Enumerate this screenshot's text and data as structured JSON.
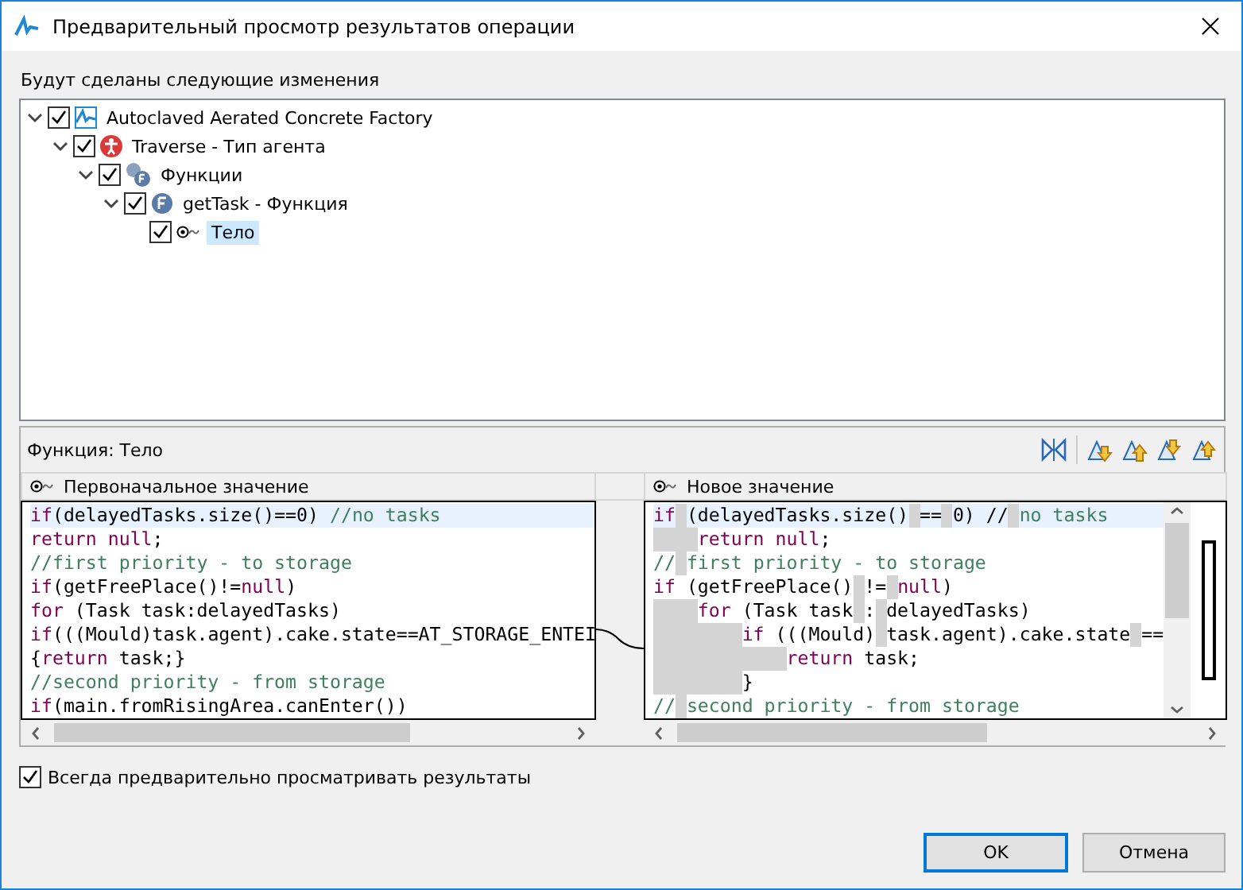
{
  "window": {
    "title": "Предварительный просмотр результатов операции"
  },
  "changes_label": "Будут сделаны следующие изменения",
  "tree": [
    {
      "label": "Autoclaved Aerated Concrete Factory",
      "kind": "model",
      "checked": true,
      "expanded": true,
      "selected": false,
      "children": [
        {
          "label": "Traverse - Тип агента",
          "kind": "agent",
          "checked": true,
          "expanded": true,
          "selected": false,
          "children": [
            {
              "label": "Функции",
              "kind": "functions",
              "checked": true,
              "expanded": true,
              "selected": false,
              "children": [
                {
                  "label": "getTask - Функция",
                  "kind": "function",
                  "checked": true,
                  "expanded": true,
                  "selected": false,
                  "children": [
                    {
                      "label": "Тело",
                      "kind": "body",
                      "checked": true,
                      "selected": true
                    }
                  ]
                }
              ]
            }
          ]
        }
      ]
    }
  ],
  "compare": {
    "title": "Функция: Тело",
    "left": {
      "header": "Первоначальное значение",
      "lines": [
        [
          {
            "kind": "kw",
            "text": "if"
          },
          {
            "kind": "tx",
            "text": "(delayedTasks.size()==0) "
          },
          {
            "kind": "cm",
            "text": "//no tasks"
          }
        ],
        [
          {
            "kind": "kw",
            "text": "return null"
          },
          {
            "kind": "tx",
            "text": ";"
          }
        ],
        [
          {
            "kind": "cm",
            "text": "//first priority - to storage"
          }
        ],
        [
          {
            "kind": "kw",
            "text": "if"
          },
          {
            "kind": "tx",
            "text": "(getFreePlace()!="
          },
          {
            "kind": "kw",
            "text": "null"
          },
          {
            "kind": "tx",
            "text": ")"
          }
        ],
        [
          {
            "kind": "kw",
            "text": "for"
          },
          {
            "kind": "tx",
            "text": " (Task task:delayedTasks)"
          }
        ],
        [
          {
            "kind": "kw",
            "text": "if"
          },
          {
            "kind": "tx",
            "text": "(((Mould)task.agent).cake.state==AT_STORAGE_ENTEI"
          }
        ],
        [
          {
            "kind": "tx",
            "text": "{"
          },
          {
            "kind": "kw",
            "text": "return"
          },
          {
            "kind": "tx",
            "text": " task;}"
          }
        ],
        [
          {
            "kind": "cm",
            "text": "//second priority - from storage"
          }
        ],
        [
          {
            "kind": "kw",
            "text": "if"
          },
          {
            "kind": "tx",
            "text": "(main.fromRisingArea.canEnter())"
          }
        ]
      ]
    },
    "right": {
      "header": "Новое значение",
      "lines": [
        [
          {
            "kind": "kw",
            "text": "if"
          },
          {
            "kind": "gap"
          },
          {
            "kind": "tx",
            "text": "(delayedTasks.size()"
          },
          {
            "kind": "gap"
          },
          {
            "kind": "tx",
            "text": "=="
          },
          {
            "kind": "gap"
          },
          {
            "kind": "tx",
            "text": "0) //"
          },
          {
            "kind": "gap"
          },
          {
            "kind": "cm",
            "text": "no tasks"
          }
        ],
        [
          {
            "kind": "tab"
          },
          {
            "kind": "kw",
            "text": "return null"
          },
          {
            "kind": "tx",
            "text": ";"
          }
        ],
        [
          {
            "kind": "cm",
            "text": "//"
          },
          {
            "kind": "gap"
          },
          {
            "kind": "cm",
            "text": "first priority - to storage"
          }
        ],
        [
          {
            "kind": "kw",
            "text": "if"
          },
          {
            "kind": "tx",
            "text": " (getFreePlace()"
          },
          {
            "kind": "gap"
          },
          {
            "kind": "tx",
            "text": "!="
          },
          {
            "kind": "gap"
          },
          {
            "kind": "kw",
            "text": "null"
          },
          {
            "kind": "tx",
            "text": ")"
          }
        ],
        [
          {
            "kind": "tab"
          },
          {
            "kind": "kw",
            "text": "for"
          },
          {
            "kind": "tx",
            "text": " (Task task"
          },
          {
            "kind": "gap"
          },
          {
            "kind": "tx",
            "text": ":"
          },
          {
            "kind": "gap"
          },
          {
            "kind": "tx",
            "text": "delayedTasks)"
          }
        ],
        [
          {
            "kind": "tab2"
          },
          {
            "kind": "kw",
            "text": "if"
          },
          {
            "kind": "tx",
            "text": " (((Mould)"
          },
          {
            "kind": "gap"
          },
          {
            "kind": "tx",
            "text": "task.agent).cake.state"
          },
          {
            "kind": "gap"
          },
          {
            "kind": "tx",
            "text": "=="
          }
        ],
        [
          {
            "kind": "tab3"
          },
          {
            "kind": "kw",
            "text": "return"
          },
          {
            "kind": "tx",
            "text": " task;"
          }
        ],
        [
          {
            "kind": "tab2"
          },
          {
            "kind": "tx",
            "text": "}"
          }
        ],
        [
          {
            "kind": "cm",
            "text": "//"
          },
          {
            "kind": "gap"
          },
          {
            "kind": "cm",
            "text": "second priority - from storage"
          }
        ]
      ]
    }
  },
  "always_preview": {
    "label": "Всегда предварительно просматривать результаты",
    "checked": true
  },
  "buttons": [
    {
      "label": "OK",
      "default": true
    },
    {
      "label": "Отмена",
      "default": false
    }
  ]
}
